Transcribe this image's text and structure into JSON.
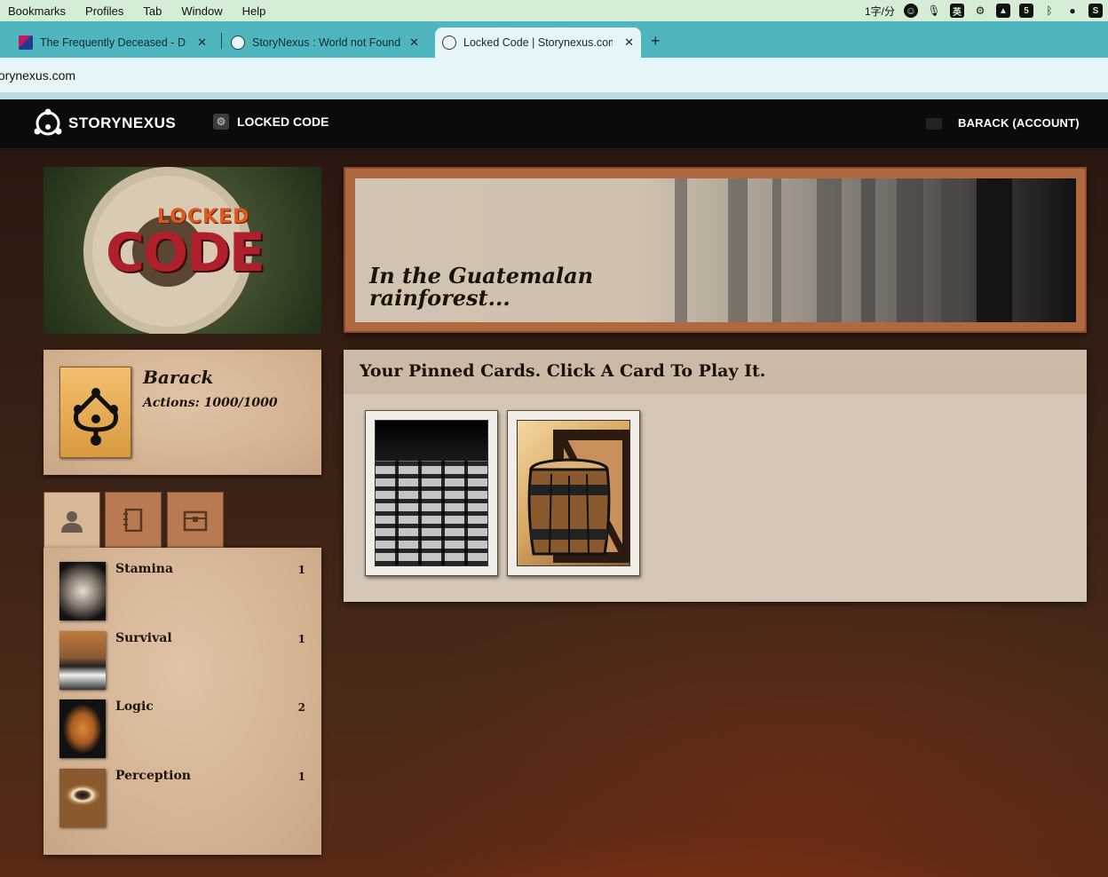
{
  "menubar": {
    "items": [
      "Bookmarks",
      "Profiles",
      "Tab",
      "Window",
      "Help"
    ],
    "status_text": "1字/分",
    "input_method": "英"
  },
  "tabs": [
    {
      "title": "The Frequently Deceased - D",
      "favicon": "flag-icon"
    },
    {
      "title": "StoryNexus : World not Found",
      "favicon": "globe-icon"
    },
    {
      "title": "Locked Code | Storynexus.com",
      "favicon": "globe-icon",
      "active": true
    }
  ],
  "address": {
    "url": "torynexus.com"
  },
  "site": {
    "brand": "STORYNEXUS",
    "world": "LOCKED CODE",
    "account": "BARACK (ACCOUNT)"
  },
  "banner": {
    "top_word": "LOCKED",
    "big_word": "CODE"
  },
  "character": {
    "name": "Barack",
    "actions": "Actions: 1000/1000"
  },
  "side_tabs": [
    "person-icon",
    "notebook-icon",
    "chest-icon"
  ],
  "stats": [
    {
      "name": "Stamina",
      "value": "1",
      "icon": "fist-icon"
    },
    {
      "name": "Survival",
      "value": "1",
      "icon": "mountain-icon"
    },
    {
      "name": "Logic",
      "value": "2",
      "icon": "brain-icon"
    },
    {
      "name": "Perception",
      "value": "1",
      "icon": "eye-icon"
    }
  ],
  "location": {
    "line1": "In the Guatemalan",
    "line2": "rainforest..."
  },
  "cards": {
    "title": "Your Pinned Cards. Click A Card To Play It.",
    "items": [
      "cobblestone-card",
      "barrel-card"
    ]
  },
  "colors": {
    "menubar": "#d5ecd5",
    "tabbar": "#4fb5bf",
    "active_tab": "#e6f6f8",
    "header": "#0b0b0b"
  }
}
